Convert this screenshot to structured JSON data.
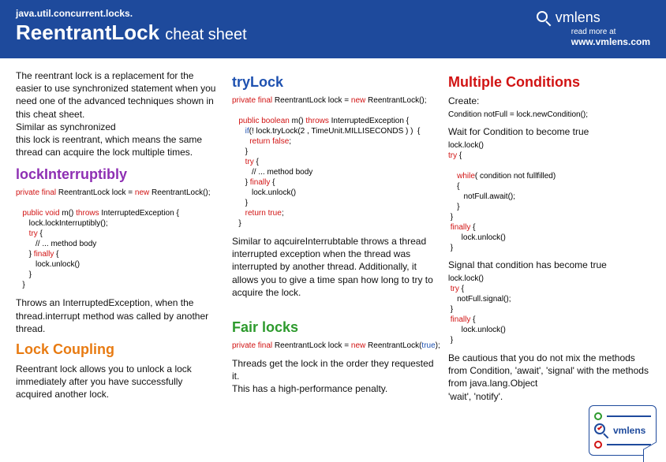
{
  "header": {
    "package": "java.util.concurrent.locks.",
    "title": "ReentrantLock",
    "subtitle": "cheat sheet",
    "brand": "vmlens",
    "read_more": "read more at",
    "url": "www.vmlens.com"
  },
  "col1": {
    "intro": "The reentrant lock is a replacement for the easier to use synchronized statement when you need one of the advanced techniques shown in this cheat sheet.\nSimilar as synchronized\n this lock is reentrant, which means the same thread can acquire the lock multiple times.",
    "h_lockInt": "lockInterruptibly",
    "code_lockInt_l1a": "private final ",
    "code_lockInt_l1b": "ReentrantLock lock = ",
    "code_lockInt_l1c": "new ",
    "code_lockInt_l1d": "ReentrantLock();",
    "code_lockInt_l2a": "   public void ",
    "code_lockInt_l2b": "m() ",
    "code_lockInt_l2c": "throws ",
    "code_lockInt_l2d": "InterruptedException {",
    "code_lockInt_l3": "      lock.lockInterruptibly();",
    "code_lockInt_l4a": "      try",
    "code_lockInt_l4b": " {",
    "code_lockInt_l5": "         // ... method body",
    "code_lockInt_l6a": "      } ",
    "code_lockInt_l6b": "finally",
    "code_lockInt_l6c": " {",
    "code_lockInt_l7": "         lock.unlock()",
    "code_lockInt_l8": "      }",
    "code_lockInt_l9": "   }",
    "para_lockInt": "Throws an InterruptedException, when the thread.interrupt method was called by another thread.",
    "h_lockCoup": "Lock Coupling",
    "para_lockCoup": "Reentrant lock allows you to unlock a  lock immediately after you have successfully acquired another lock."
  },
  "col2": {
    "h_tryLock": "tryLock",
    "code_try_l1a": "private final ",
    "code_try_l1b": "ReentrantLock lock = ",
    "code_try_l1c": "new ",
    "code_try_l1d": "ReentrantLock();",
    "code_try_l2a": "   public boolean ",
    "code_try_l2b": "m() ",
    "code_try_l2c": "throws ",
    "code_try_l2d": "InterruptedException {",
    "code_try_l3a": "      if",
    "code_try_l3b": "(! lock.tryLock(2 , TimeUnit.MILLISECONDS ) )  {",
    "code_try_l4a": "        return false",
    "code_try_l4b": ";",
    "code_try_l5": "      }",
    "code_try_l6a": "      try",
    "code_try_l6b": " {",
    "code_try_l7": "         // ... method body",
    "code_try_l8a": "      } ",
    "code_try_l8b": "finally",
    "code_try_l8c": " {",
    "code_try_l9": "         lock.unlock()",
    "code_try_l10": "      }",
    "code_try_l11a": "      return true",
    "code_try_l11b": ";",
    "code_try_l12": "   }",
    "para_tryLock": "Similar to aqcuireInterrubtable throws a thread interrupted exception when the thread was interrupted by another thread. Additionally, it allows you to give a time span how long to try to acquire the lock.",
    "h_fair": "Fair locks",
    "code_fair_a": "private final ",
    "code_fair_b": "ReentrantLock lock = ",
    "code_fair_c": "new ",
    "code_fair_d": "ReentrantLock(",
    "code_fair_e": "true",
    "code_fair_f": ");",
    "para_fair": "Threads get the lock in the order they requested it.\nThis has a high-performance penalty."
  },
  "col3": {
    "h_multi": "Multiple Conditions",
    "sub_create": "Create:",
    "code_create": "Condition notFull = lock.newCondition();",
    "sub_wait": "Wait for Condition to become true",
    "code_wait_l1": "lock.lock()",
    "code_wait_l2a": "try",
    "code_wait_l2b": " {",
    "code_wait_l3a": "    while",
    "code_wait_l3b": "( condition not fullfilled)",
    "code_wait_l4": "    {",
    "code_wait_l5": "       notFull.await();",
    "code_wait_l6": "    }",
    "code_wait_l7": " }",
    "code_wait_l8a": " finally",
    "code_wait_l8b": " {",
    "code_wait_l9": "      lock.unlock()",
    "code_wait_l10": " }",
    "sub_signal": "Signal that condition has become true",
    "code_sig_l1": "lock.lock()",
    "code_sig_l2a": " try",
    "code_sig_l2b": " {",
    "code_sig_l3": "    notFull.signal();",
    "code_sig_l4": " }",
    "code_sig_l5a": " finally",
    "code_sig_l5b": " {",
    "code_sig_l6": "      lock.unlock()",
    "code_sig_l7": " }",
    "para_caution": "Be cautious that you do not mix  the methods from Condition, 'await', 'signal' with the methods from java.lang.Object\n'wait', 'notify'."
  },
  "footer": {
    "brand": "vmlens"
  }
}
